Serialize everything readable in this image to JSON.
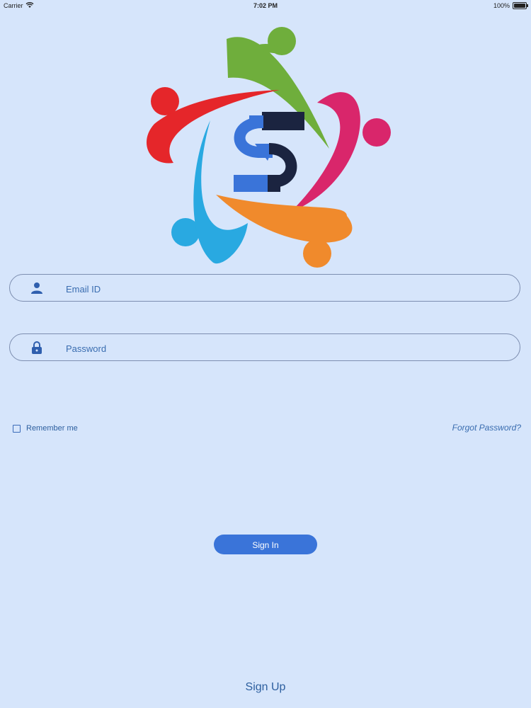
{
  "status_bar": {
    "carrier": "Carrier",
    "time": "7:02 PM",
    "battery": "100%"
  },
  "logo": {
    "name": "people-circle-dollar-logo",
    "colors": {
      "green": "#6fae3c",
      "magenta": "#d9266b",
      "orange": "#f08a2c",
      "blue": "#29a9e1",
      "red": "#e5262a",
      "dollar_light": "#3a74d9",
      "dollar_dark": "#1b2440"
    }
  },
  "form": {
    "email_placeholder": "Email ID",
    "password_placeholder": "Password",
    "remember_label": "Remember me",
    "forgot_label": "Forgot Password?",
    "signin_label": "Sign In",
    "signup_label": "Sign Up"
  },
  "colors": {
    "background": "#d6e5fb",
    "accent": "#3a74d9",
    "text": "#2d5f9f"
  },
  "icons": {
    "wifi": "wifi-icon",
    "user": "user-icon",
    "lock": "lock-icon",
    "battery": "battery-icon"
  }
}
